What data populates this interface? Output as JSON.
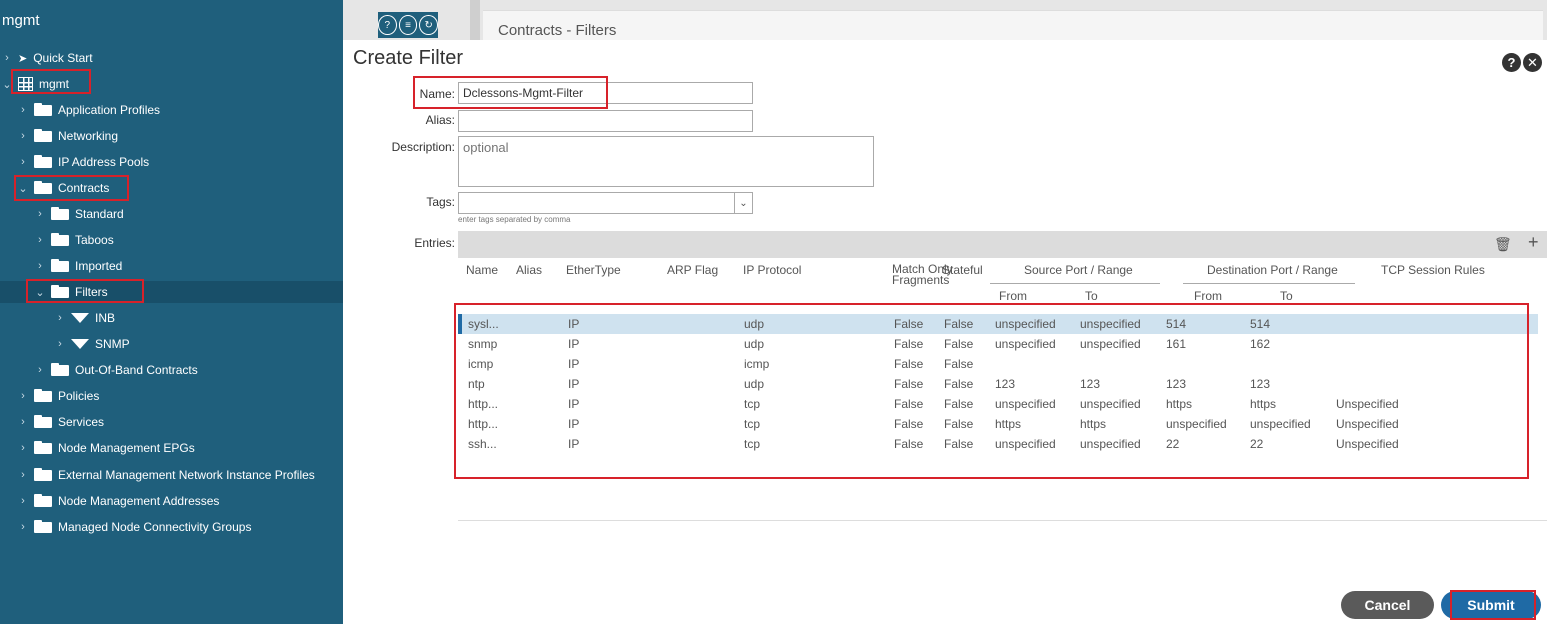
{
  "sidebar": {
    "title": "mgmt",
    "items": [
      {
        "label": "Quick Start",
        "level": 0,
        "icon": "quick-start-icon"
      },
      {
        "label": "mgmt",
        "level": 0,
        "icon": "tenant-grid-icon"
      },
      {
        "label": "Application Profiles",
        "level": 1,
        "icon": "folder-icon"
      },
      {
        "label": "Networking",
        "level": 1,
        "icon": "folder-icon"
      },
      {
        "label": "IP Address Pools",
        "level": 1,
        "icon": "folder-icon"
      },
      {
        "label": "Contracts",
        "level": 1,
        "icon": "folder-icon"
      },
      {
        "label": "Standard",
        "level": 2,
        "icon": "folder-icon"
      },
      {
        "label": "Taboos",
        "level": 2,
        "icon": "folder-icon"
      },
      {
        "label": "Imported",
        "level": 2,
        "icon": "folder-icon"
      },
      {
        "label": "Filters",
        "level": 2,
        "icon": "folder-icon"
      },
      {
        "label": "INB",
        "level": 3,
        "icon": "filter-icon"
      },
      {
        "label": "SNMP",
        "level": 3,
        "icon": "filter-icon"
      },
      {
        "label": "Out-Of-Band Contracts",
        "level": 2,
        "icon": "folder-icon"
      },
      {
        "label": "Policies",
        "level": 1,
        "icon": "folder-icon"
      },
      {
        "label": "Services",
        "level": 1,
        "icon": "folder-icon"
      },
      {
        "label": "Node Management EPGs",
        "level": 1,
        "icon": "folder-icon"
      },
      {
        "label": "External Management Network Instance Profiles",
        "level": 1,
        "icon": "folder-icon"
      },
      {
        "label": "Node Management Addresses",
        "level": 1,
        "icon": "folder-icon"
      },
      {
        "label": "Managed Node Connectivity Groups",
        "level": 1,
        "icon": "folder-icon"
      }
    ]
  },
  "header": {
    "breadcrumb": "Contracts - Filters"
  },
  "dialog": {
    "title": "Create Filter",
    "name_label": "Name:",
    "name_value": "Dclessons-Mgmt-Filter",
    "alias_label": "Alias:",
    "alias_value": "",
    "description_label": "Description:",
    "description_placeholder": "optional",
    "tags_label": "Tags:",
    "tags_hint": "enter tags separated by comma",
    "entries_label": "Entries:"
  },
  "table": {
    "headers": {
      "name": "Name",
      "alias": "Alias",
      "ethertype": "EtherType",
      "arp_flag": "ARP Flag",
      "ip_protocol": "IP Protocol",
      "match_only_fragments": "Match Only Fragments",
      "stateful": "Stateful",
      "source_port_range": "Source Port / Range",
      "destination_port_range": "Destination Port / Range",
      "tcp_session_rules": "TCP Session Rules",
      "from": "From",
      "to": "To"
    },
    "rows": [
      {
        "name": "sysl...",
        "ethertype": "IP",
        "ip_protocol": "udp",
        "match_only": "False",
        "stateful": "False",
        "src_from": "unspecified",
        "src_to": "unspecified",
        "dst_from": "514",
        "dst_to": "514",
        "tcp_rules": ""
      },
      {
        "name": "snmp",
        "ethertype": "IP",
        "ip_protocol": "udp",
        "match_only": "False",
        "stateful": "False",
        "src_from": "unspecified",
        "src_to": "unspecified",
        "dst_from": "161",
        "dst_to": "162",
        "tcp_rules": ""
      },
      {
        "name": "icmp",
        "ethertype": "IP",
        "ip_protocol": "icmp",
        "match_only": "False",
        "stateful": "False",
        "src_from": "",
        "src_to": "",
        "dst_from": "",
        "dst_to": "",
        "tcp_rules": ""
      },
      {
        "name": "ntp",
        "ethertype": "IP",
        "ip_protocol": "udp",
        "match_only": "False",
        "stateful": "False",
        "src_from": "123",
        "src_to": "123",
        "dst_from": "123",
        "dst_to": "123",
        "tcp_rules": ""
      },
      {
        "name": "http...",
        "ethertype": "IP",
        "ip_protocol": "tcp",
        "match_only": "False",
        "stateful": "False",
        "src_from": "unspecified",
        "src_to": "unspecified",
        "dst_from": "https",
        "dst_to": "https",
        "tcp_rules": "Unspecified"
      },
      {
        "name": "http...",
        "ethertype": "IP",
        "ip_protocol": "tcp",
        "match_only": "False",
        "stateful": "False",
        "src_from": "https",
        "src_to": "https",
        "dst_from": "unspecified",
        "dst_to": "unspecified",
        "tcp_rules": "Unspecified"
      },
      {
        "name": "ssh...",
        "ethertype": "IP",
        "ip_protocol": "tcp",
        "match_only": "False",
        "stateful": "False",
        "src_from": "unspecified",
        "src_to": "unspecified",
        "dst_from": "22",
        "dst_to": "22",
        "tcp_rules": "Unspecified"
      }
    ]
  },
  "buttons": {
    "cancel": "Cancel",
    "submit": "Submit"
  },
  "colors": {
    "sidebar_bg": "#1f5f7c",
    "accent": "#1f6aa5",
    "highlight_red": "#d7222a"
  }
}
